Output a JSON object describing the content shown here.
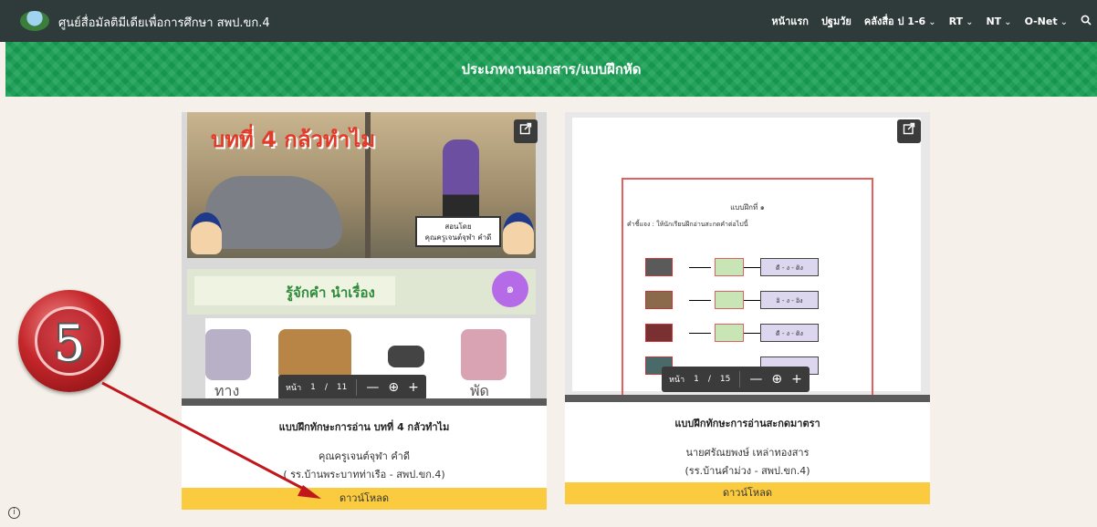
{
  "header": {
    "site_title": "ศูนย์สื่อมัลติมีเดียเพื่อการศึกษา สพป.ขก.4",
    "nav": [
      {
        "label": "หน้าแรก",
        "has_dropdown": false
      },
      {
        "label": "ปฐมวัย",
        "has_dropdown": false
      },
      {
        "label": "คลังสื่อ ป 1-6",
        "has_dropdown": true
      },
      {
        "label": "RT",
        "has_dropdown": true
      },
      {
        "label": "NT",
        "has_dropdown": true
      },
      {
        "label": "O-Net",
        "has_dropdown": true
      }
    ],
    "chevron": "⌄",
    "search_icon": "search-icon"
  },
  "banner": {
    "title": "ประเภทงานเอกสาร/แบบฝึกหัด",
    "color": "#18a055"
  },
  "cards": [
    {
      "preview": {
        "headline": "บทที่ 4 กล้วทำไม",
        "sign_line1": "สอนโดย",
        "sign_line2": "คุณครูเจนต์จุฬา คำดี",
        "section": "รู้จักคำ นำเรื่อง",
        "badge": "๑",
        "words": [
          "ทาง",
          "พัด"
        ],
        "page_label": "หน้า",
        "page_current": "1",
        "page_sep": "/",
        "page_total": "11",
        "minus": "—",
        "zoom": "⊕",
        "plus": "+"
      },
      "title": "แบบฝึกทักษะการอ่าน บทที่ 4 กลัวทำไม",
      "author": "คุณครูเจนต์จุฬา คำดี",
      "school": "( รร.บ้านพระบาทท่าเรือ - สพป.ขก.4)",
      "download_label": "ดาวน์โหลด"
    },
    {
      "preview": {
        "doc_title": "แบบฝึกที่ ๑",
        "doc_instruction": "คำชี้แจง : ให้นักเรียนฝึกอ่านสะกดคำต่อไปนี้",
        "rows": [
          "ดี - ง - ดิง",
          "อิ - ง - อิง",
          "ดี - ง - ดิง",
          ""
        ],
        "page_label": "หน้า",
        "page_current": "1",
        "page_sep": "/",
        "page_total": "15",
        "minus": "—",
        "zoom": "⊕",
        "plus": "+"
      },
      "title": "แบบฝึกทักษะการอ่านสะกดมาตรา",
      "author": "นายศรัณยพงษ์ เหล่าทองสาร",
      "school": "(รร.บ้านคำม่วง - สพป.ขก.4)",
      "download_label": "ดาวน์โหลด"
    }
  ],
  "annotation": {
    "number": "5",
    "arrow_color": "#c0161c"
  },
  "footer": {
    "info_glyph": "i"
  },
  "colors": {
    "topbar": "#2f3a3a",
    "download_button": "#fbcb3f",
    "page_background": "#f5f1ea"
  }
}
